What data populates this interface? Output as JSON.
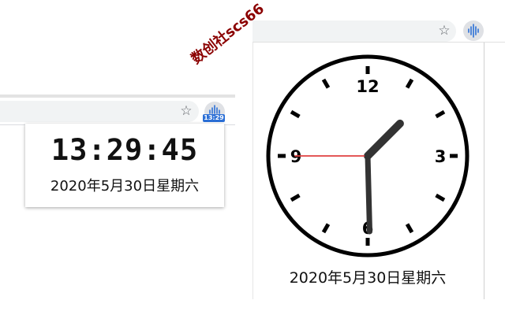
{
  "digital_popup": {
    "time": "13:29:45",
    "date": "2020年5月30日星期六"
  },
  "analog_popup": {
    "numerals": {
      "n12": "12",
      "n3": "3",
      "n6": "6",
      "n9": "9"
    },
    "date": "2020年5月30日星期六"
  },
  "clock_time": {
    "hour": 13,
    "minute": 29,
    "second": 45
  },
  "toolbar": {
    "extension_badge": "13:29",
    "bookmark_icon": "star-icon",
    "extension_icon": "waveform-icon"
  },
  "watermark": "数创社scs66",
  "colors": {
    "badge": "#2b6fd6",
    "second_hand": "#e04040",
    "hands": "#333333",
    "watermark": "#8b0000"
  }
}
